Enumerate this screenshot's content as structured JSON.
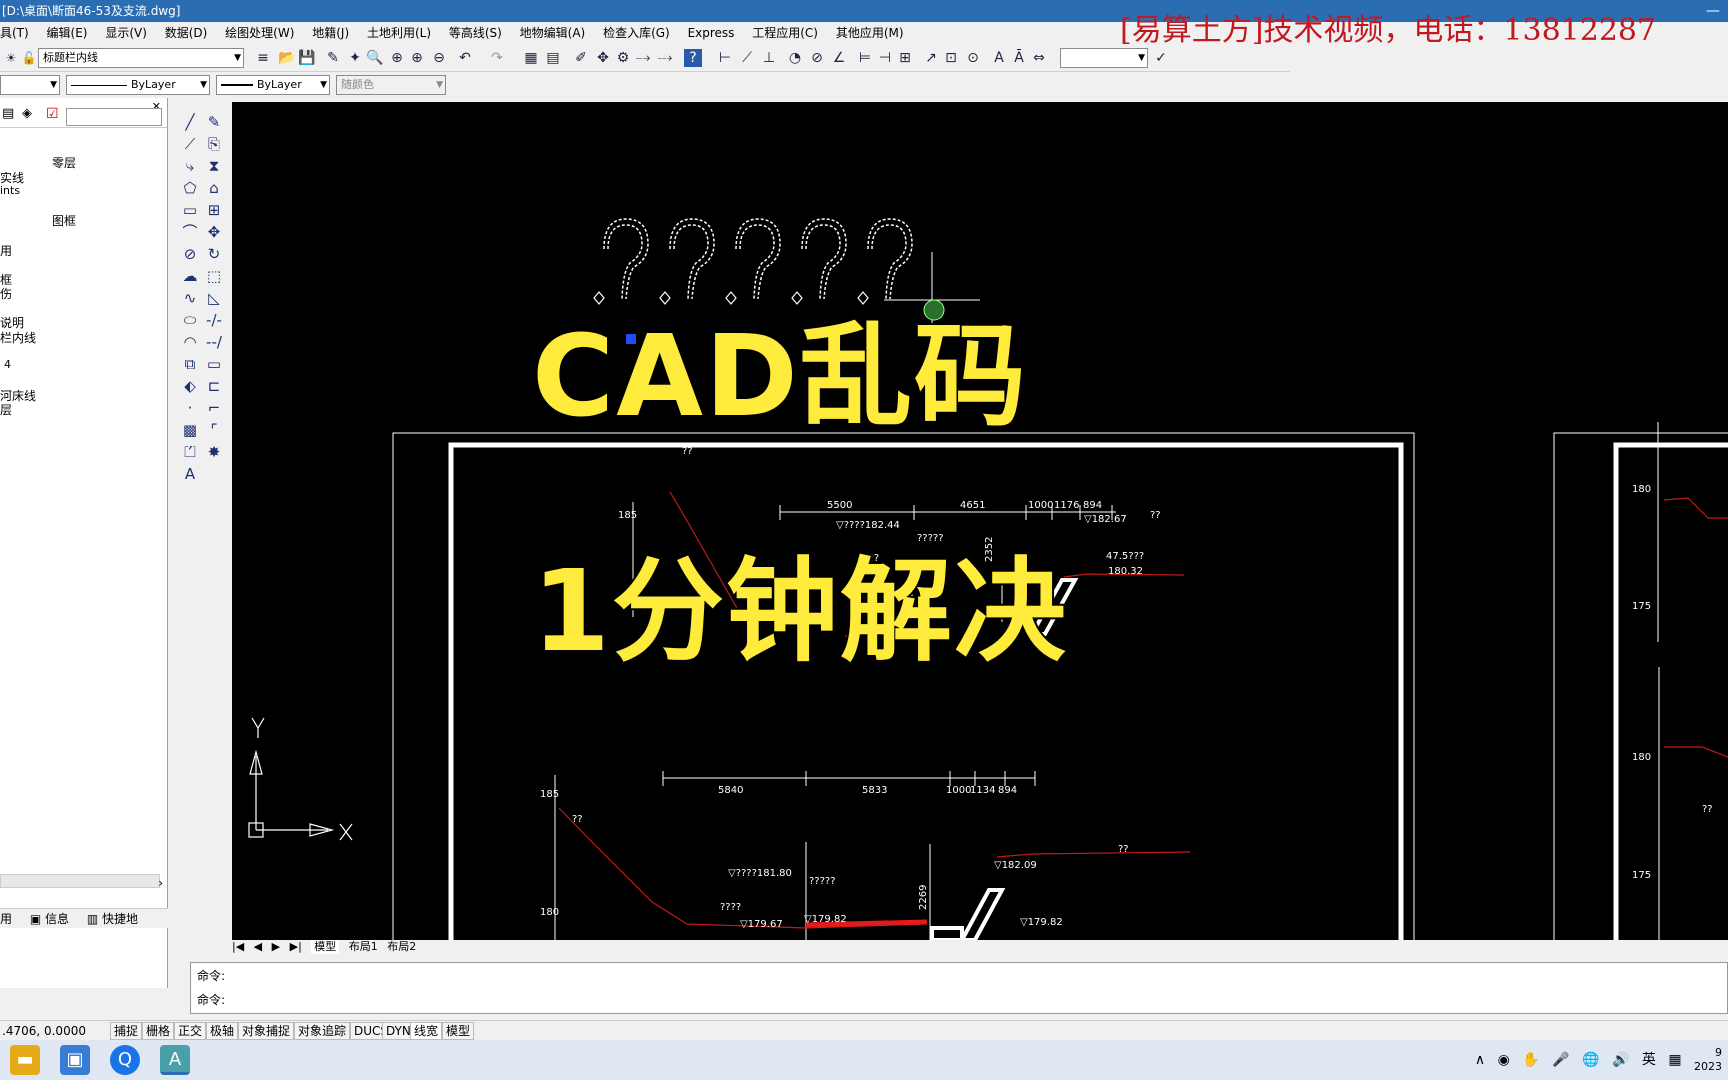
{
  "window": {
    "title": "具(T)  编辑(E)",
    "title_full": "[D:\\桌面\\断面46-53及支流.dwg]"
  },
  "menu": [
    "具(T)",
    "编辑(E)",
    "显示(V)",
    "数据(D)",
    "绘图处理(W)",
    "地籍(J)",
    "土地利用(L)",
    "等高线(S)",
    "地物编辑(A)",
    "检查入库(G)",
    "Express",
    "工程应用(C)",
    "其他应用(M)"
  ],
  "promo": "[易算土方]技术视频，电话：13812287",
  "toolbar": {
    "layer_combo": "标题栏内线",
    "linetype_combo": "ByLayer",
    "lineweight_combo": "ByLayer",
    "color_combo": "随颜色"
  },
  "layer_panel": {
    "items": [
      "零层",
      "实线",
      "ints",
      "图框",
      "用",
      "框",
      "伤",
      "说明",
      "栏内线",
      "4",
      "河床线",
      "层"
    ],
    "bottom": [
      "用",
      "信息",
      "快捷地"
    ]
  },
  "overlay": {
    "line1": "CAD乱码",
    "line2": "1分钟解决"
  },
  "drawing": {
    "question_marks": [
      "?",
      "?",
      "?",
      "?",
      "?"
    ],
    "top_section": {
      "dims": [
        "5500",
        "4651",
        "1000",
        "1176",
        "894"
      ],
      "labels": [
        "??",
        "▽????182.44",
        "?????",
        "????",
        "2352",
        "▽182.67",
        "??",
        "47.5???",
        "180.32",
        "185"
      ]
    },
    "bottom_section": {
      "dims": [
        "5840",
        "5833",
        "1000",
        "1134",
        "894"
      ],
      "labels": [
        "??",
        "▽????181.80",
        "?????",
        "????",
        "▽179.67",
        "▽179.82",
        "2269",
        "▽182.09",
        "??",
        "▽179.82",
        "185",
        "180"
      ]
    },
    "right_labels": [
      "180",
      "175",
      "180",
      "175",
      "??"
    ]
  },
  "tabs": [
    "模型",
    "布局1",
    "布局2"
  ],
  "command": {
    "line1": "命令:",
    "line2": "命令:"
  },
  "status": {
    "coords": ".4706,  0.0000",
    "buttons": [
      "捕捉",
      "栅格",
      "正交",
      "极轴",
      "对象捕捉",
      "对象追踪",
      "DUCS",
      "DYN",
      "线宽",
      "模型"
    ]
  },
  "taskbar": {
    "ime": "英",
    "year": "2023",
    "hint": "9"
  }
}
